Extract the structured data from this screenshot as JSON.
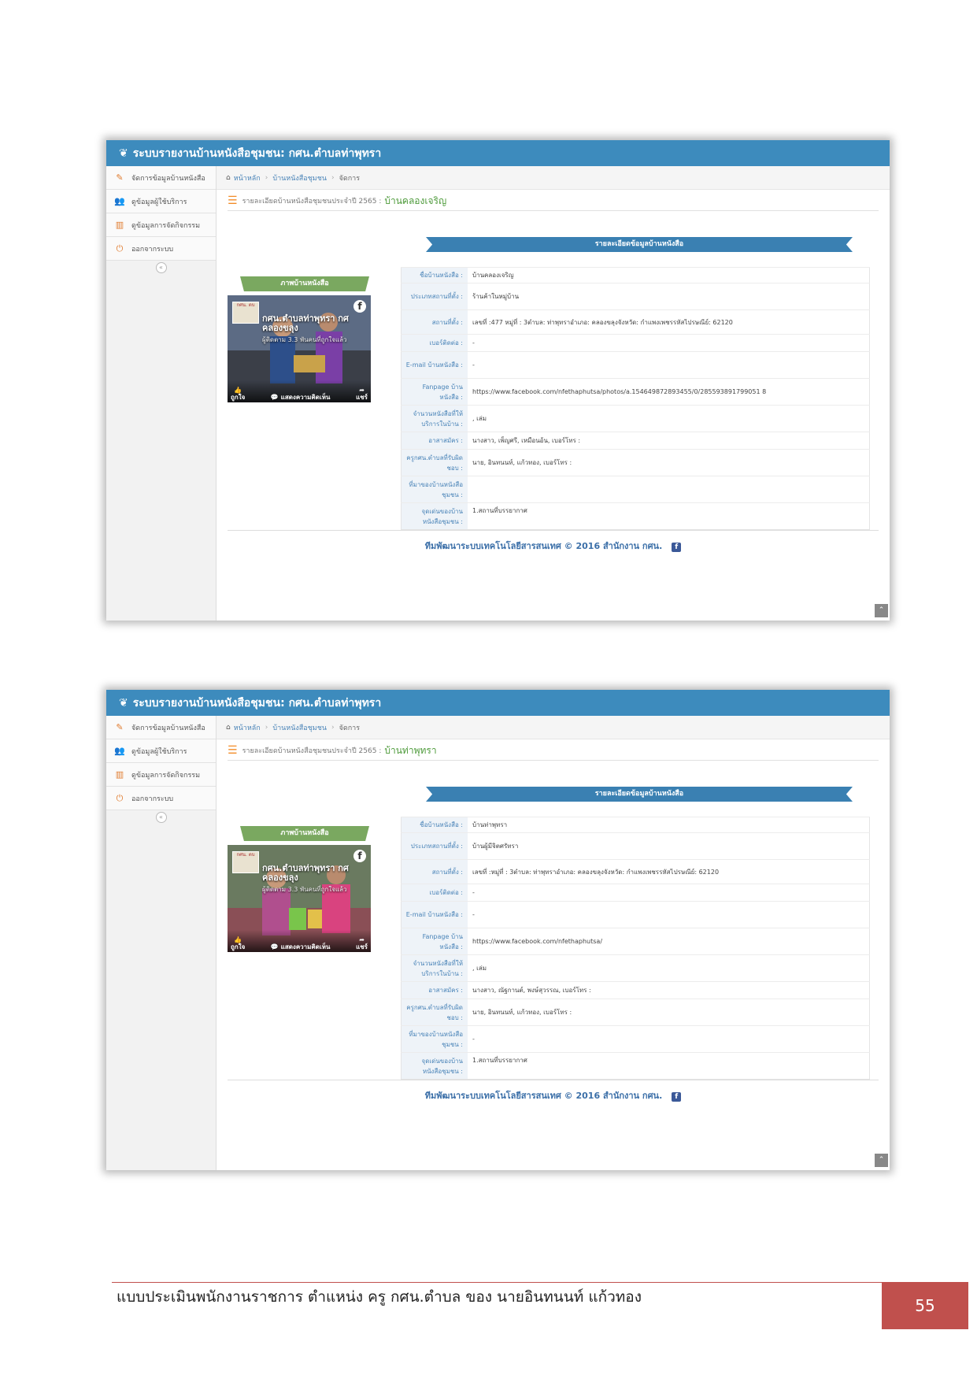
{
  "screens": [
    {
      "title": "ระบบรายงานบ้านหนังสือชุมชน: กศน.ตำบลท่าพุทรา",
      "sidebar": [
        "จัดการข้อมูลบ้านหนังสือ",
        "ดูข้อมูลผู้ใช้บริการ",
        "ดูข้อมูลการจัดกิจกรรม",
        "ออกจากระบบ"
      ],
      "breadcrumb": [
        "หน้าหลัก",
        "บ้านหนังสือชุมชน",
        "จัดการ"
      ],
      "report_label": "รายละเอียดบ้านหนังสือชุมชนประจำปี 2565 :",
      "report_name": "บ้านคลองเจริญ",
      "banner": "รายละเอียดข้อมูลบ้านหนังสือ",
      "image_title": "ภาพบ้านหนังสือ",
      "fb": {
        "name": "กศน.ตำบลท่าพุทรา กศ คลองขลุง",
        "sub": "ผู้ติดตาม 3.3 พันคนที่ถูกใจแล้ว",
        "thumb": "กศน. ตบ",
        "like": "ถูกใจ",
        "comment": "แสดงความคิดเห็น",
        "share": "แชร์"
      },
      "fields": [
        {
          "k": "ชื่อบ้านหนังสือ :",
          "v": "บ้านคลองเจริญ"
        },
        {
          "k": "ประเภทสถานที่ตั้ง :",
          "v": "ร้านค้าในหมู่บ้าน"
        },
        {
          "k": "สถานที่ตั้ง :",
          "v": "เลขที่ :477 หมู่ที่ : 3ตำบล: ท่าพุทราอำเภอ: คลองขลุงจังหวัด: กำแพงเพชรรหัสไปรษณีย์: 62120"
        },
        {
          "k": "เบอร์ติดต่อ :",
          "v": "-"
        },
        {
          "k": "E-mail บ้านหนังสือ :",
          "v": "-"
        },
        {
          "k": "Fanpage บ้านหนังสือ :",
          "v": "https://www.facebook.com/nfethaphutsa/photos/a.154649872893455/0/285593891799051 8"
        },
        {
          "k": "จำนวนหนังสือที่ให้บริการในบ้าน :",
          "v": ", เล่ม"
        },
        {
          "k": "อาสาสมัคร :",
          "v": "นางสาว, เพ็ญศรี, เหมือนอ้น, เบอร์โทร :"
        },
        {
          "k": "ครูกศน.ตำบลที่รับผิดชอบ :",
          "v": "นาย, อินทนนท์, แก้วทอง, เบอร์โทร :"
        },
        {
          "k": "ที่มาของบ้านหนังสือชุมชน :",
          "v": ""
        },
        {
          "k": "จุดเด่นของบ้านหนังสือชุมชน :",
          "v": "1.สถานที่บรรยากาศ"
        }
      ],
      "footer": "ทีมพัฒนาระบบเทคโนโลยีสารสนเทศ © 2016 สำนักงาน กศน."
    },
    {
      "title": "ระบบรายงานบ้านหนังสือชุมชน: กศน.ตำบลท่าพุทรา",
      "sidebar": [
        "จัดการข้อมูลบ้านหนังสือ",
        "ดูข้อมูลผู้ใช้บริการ",
        "ดูข้อมูลการจัดกิจกรรม",
        "ออกจากระบบ"
      ],
      "breadcrumb": [
        "หน้าหลัก",
        "บ้านหนังสือชุมชน",
        "จัดการ"
      ],
      "report_label": "รายละเอียดบ้านหนังสือชุมชนประจำปี 2565 :",
      "report_name": "บ้านท่าพุทรา",
      "banner": "รายละเอียดข้อมูลบ้านหนังสือ",
      "image_title": "ภาพบ้านหนังสือ",
      "fb": {
        "name": "กศน.ตำบลท่าพุทรา กศ คลองขลุง",
        "sub": "ผู้ติดตาม 3.3 พันคนที่ถูกใจแล้ว",
        "thumb": "กศน. ตบ",
        "like": "ถูกใจ",
        "comment": "แสดงความคิดเห็น",
        "share": "แชร์"
      },
      "fields": [
        {
          "k": "ชื่อบ้านหนังสือ :",
          "v": "บ้านท่าพุทรา"
        },
        {
          "k": "ประเภทสถานที่ตั้ง :",
          "v": "บ้านผู้มีจิตศรัทรา"
        },
        {
          "k": "สถานที่ตั้ง :",
          "v": "เลขที่ :หมู่ที่ : 3ตำบล: ท่าพุทราอำเภอ: คลองขลุงจังหวัด: กำแพงเพชรรหัสไปรษณีย์: 62120"
        },
        {
          "k": "เบอร์ติดต่อ :",
          "v": "-"
        },
        {
          "k": "E-mail บ้านหนังสือ :",
          "v": "-"
        },
        {
          "k": "Fanpage บ้านหนังสือ :",
          "v": "https://www.facebook.com/nfethaphutsa/"
        },
        {
          "k": "จำนวนหนังสือที่ให้บริการในบ้าน :",
          "v": ", เล่ม"
        },
        {
          "k": "อาสาสมัคร :",
          "v": "นางสาว, ณัฐกานต์, พงษ์สุวรรณ, เบอร์โทร :"
        },
        {
          "k": "ครูกศน.ตำบลที่รับผิดชอบ :",
          "v": "นาย, อินทนนท์, แก้วทอง, เบอร์โทร :"
        },
        {
          "k": "ที่มาของบ้านหนังสือชุมชน :",
          "v": "-"
        },
        {
          "k": "จุดเด่นของบ้านหนังสือชุมชน :",
          "v": "1.สถานที่บรรยากาศ"
        }
      ],
      "footer": "ทีมพัฒนาระบบเทคโนโลยีสารสนเทศ © 2016 สำนักงาน กศน."
    }
  ],
  "page_footer": "แบบประเมินพนักงานราชการ ตำแหน่ง ครู กศน.ตำบล ของ นายอินทนนท์ แก้วทอง",
  "page_number": "55"
}
